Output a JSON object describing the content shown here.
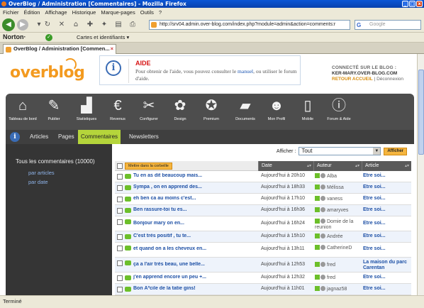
{
  "window": {
    "title": "OverBlog / Administration [Commentaires] - Mozilla Firefox"
  },
  "menubar": {
    "items": [
      "Fichier",
      "Édition",
      "Affichage",
      "Historique",
      "Marque-pages",
      "Outils",
      "?"
    ]
  },
  "navbar": {
    "url": "http://srv04.admin.over-blog.com/index.php?module=admin&action=comments:r",
    "search_placeholder": "Google"
  },
  "norton": {
    "brand": "Norton·",
    "cards_label": "Cartes et identifiants ▾"
  },
  "tab": {
    "label": "OverBlog / Administration [Commen..."
  },
  "header": {
    "logo_text": "overblog",
    "aide": {
      "title": "AIDE",
      "text_before": "Pour obtenir de l'aide, vous pouvez consulter le ",
      "link": "manuel",
      "text_after": ", ou utiliser le forum d'aide."
    },
    "connected": {
      "label": "CONNECTÉ SUR LE BLOG :",
      "blog": "KER-MARY.OVER-BLOG.COM",
      "retour": "RETOUR ACCUEIL",
      "separator": " | ",
      "deconnexion": "Déconnexion"
    }
  },
  "admin_toolbar": {
    "buttons": [
      {
        "label": "Tableau de bord",
        "icon": "home-icon"
      },
      {
        "label": "Publier",
        "icon": "pen-icon"
      },
      {
        "label": "Statistiques",
        "icon": "chart-icon"
      },
      {
        "label": "Revenus",
        "icon": "euro-icon"
      },
      {
        "label": "Configurer",
        "icon": "tools-icon"
      },
      {
        "label": "Design",
        "icon": "palette-icon"
      },
      {
        "label": "Premium",
        "icon": "medal-icon"
      },
      {
        "label": "Documents",
        "icon": "folder-icon"
      },
      {
        "label": "Mon Profil",
        "icon": "user-icon"
      },
      {
        "label": "Mobile",
        "icon": "mobile-icon"
      },
      {
        "label": "Forum & Aide",
        "icon": "info-icon"
      }
    ]
  },
  "subtabs": [
    "Articles",
    "Pages",
    "Commentaires",
    "Newsletters"
  ],
  "sidebar": {
    "all_label": "Tous les commentaires (10000)",
    "links": [
      "par articles",
      "par date"
    ]
  },
  "filter": {
    "label": "Afficher :",
    "value": "Tout",
    "button": "Afficher"
  },
  "grid": {
    "trash_button": "Mettre dans la corbeille",
    "columns": [
      "Date",
      "Auteur",
      "Article"
    ],
    "rows": [
      {
        "text": "Tu en as dit beaucoup mais...",
        "date": "Aujourd'hui à 20h10",
        "author": "Alba",
        "article": "Etre soi..."
      },
      {
        "text": "Sympa , on en apprend des...",
        "date": "Aujourd'hui à 18h33",
        "author": "Mélissa",
        "article": "Etre soi..."
      },
      {
        "text": "eh ben ca au moins c'est...",
        "date": "Aujourd'hui à 17h10",
        "author": "vaness",
        "article": "Etre soi..."
      },
      {
        "text": "Ben rassure-toi tu es...",
        "date": "Aujourd'hui à 16h36",
        "author": "amaryves",
        "article": "Etre soi..."
      },
      {
        "text": "Bonjour mary on en...",
        "date": "Aujourd'hui à 16h24",
        "author": "Domie de la reunion",
        "article": "Etre soi..."
      },
      {
        "text": "C'est très positif , tu te...",
        "date": "Aujourd'hui à 15h10",
        "author": "Andrée",
        "article": "Etre soi..."
      },
      {
        "text": "et quand on a les cheveux en...",
        "date": "Aujourd'hui à 13h11",
        "author": "CatherineD",
        "article": "Etre soi..."
      },
      {
        "text": "ça a l'air très beau, une belle...",
        "date": "Aujourd'hui à 12h53",
        "author": "fred",
        "article": "La maison du parc Carentan"
      },
      {
        "text": "j'en apprend encore un peu +...",
        "date": "Aujourd'hui à 12h32",
        "author": "fred",
        "article": "Etre soi..."
      },
      {
        "text": "Bon Ãºcile de la tatie gins!",
        "date": "Aujourd'hui à 11h01",
        "author": "jagnaz58",
        "article": "Etre soi..."
      }
    ]
  },
  "status": {
    "text": "Terminé"
  }
}
